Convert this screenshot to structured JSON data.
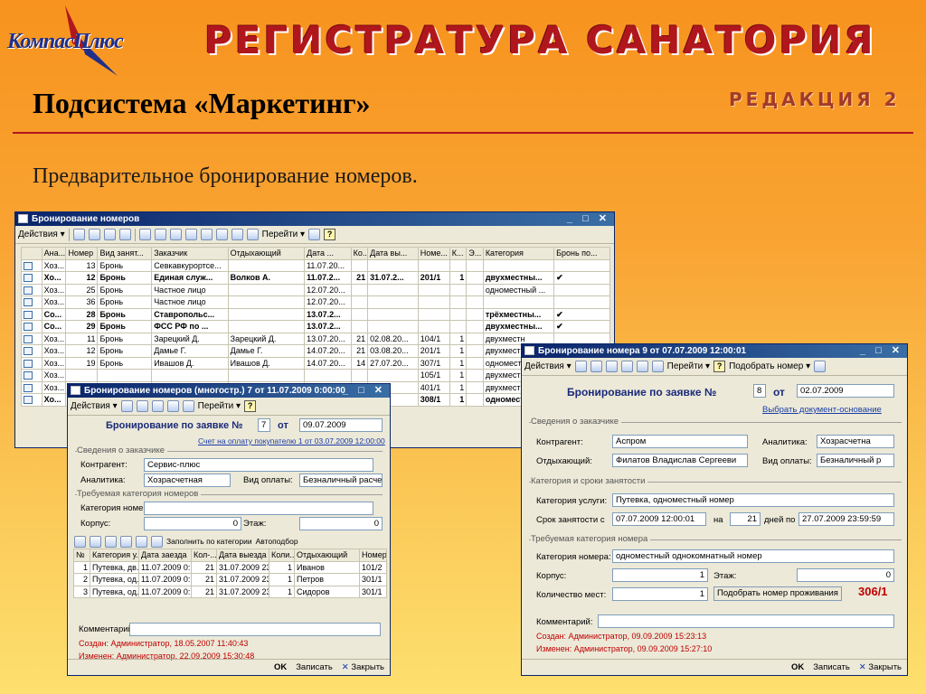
{
  "header": {
    "logo": "КомпасПлюс",
    "banner": "РЕГИСТРАТУРА САНАТОРИЯ",
    "edition": "РЕДАКЦИЯ 2",
    "page_title": "Подсистема «Маркетинг»",
    "subtitle": "Предварительное бронирование номеров."
  },
  "list_window": {
    "title": "Бронирование номеров",
    "controls": "_ □ ✕",
    "toolbar": {
      "actions": "Действия",
      "goto": "Перейти",
      "help": "?"
    },
    "columns": [
      "",
      "Ана...",
      "Номер",
      "Вид занят...",
      "Заказчик",
      "Отдыхающий",
      "Дата ...",
      "Ко...",
      "Дата вы...",
      "Номе...",
      "К...",
      "Э...",
      "Категория",
      "Бронь по..."
    ],
    "rows": [
      {
        "b": false,
        "c": [
          "Хоз...",
          "13",
          "Бронь",
          "Севкавкурортсе...",
          "",
          "11.07.20...",
          "",
          "",
          "",
          "",
          "",
          "",
          ""
        ]
      },
      {
        "b": true,
        "c": [
          "Хо...",
          "12",
          "Бронь",
          "Единая служ...",
          "Волков А.",
          "11.07.2...",
          "21",
          "31.07.2...",
          "201/1",
          "1",
          "",
          "двухместны...",
          "✔"
        ]
      },
      {
        "b": false,
        "c": [
          "Хоз...",
          "25",
          "Бронь",
          "Частное лицо",
          "",
          "12.07.20...",
          "",
          "",
          "",
          "",
          "",
          "одноместный ...",
          ""
        ]
      },
      {
        "b": false,
        "c": [
          "Хоз...",
          "36",
          "Бронь",
          "Частное лицо",
          "",
          "12.07.20...",
          "",
          "",
          "",
          "",
          "",
          "",
          ""
        ]
      },
      {
        "b": true,
        "c": [
          "Со...",
          "28",
          "Бронь",
          "Ставропольс...",
          "",
          "13.07.2...",
          "",
          "",
          "",
          "",
          "",
          "трёхместны...",
          "✔"
        ]
      },
      {
        "b": true,
        "c": [
          "Со...",
          "29",
          "Бронь",
          "ФСС РФ по ...",
          "",
          "13.07.2...",
          "",
          "",
          "",
          "",
          "",
          "двухместны...",
          "✔"
        ]
      },
      {
        "b": false,
        "c": [
          "Хоз...",
          "11",
          "Бронь",
          "Зарецкий Д.",
          "Зарецкий Д.",
          "13.07.20...",
          "21",
          "02.08.20...",
          "104/1",
          "1",
          "",
          "двухместн",
          ""
        ]
      },
      {
        "b": false,
        "c": [
          "Хоз...",
          "12",
          "Бронь",
          "Дамье Г.",
          "Дамье Г.",
          "14.07.20...",
          "21",
          "03.08.20...",
          "201/1",
          "1",
          "",
          "двухместн",
          ""
        ]
      },
      {
        "b": false,
        "c": [
          "Хоз...",
          "19",
          "Бронь",
          "Ивашов Д.",
          "Ивашов Д.",
          "14.07.20...",
          "14",
          "27.07.20...",
          "307/1",
          "1",
          "",
          "одноместн",
          ""
        ]
      },
      {
        "b": false,
        "c": [
          "Хоз...",
          "",
          "",
          "",
          "",
          "",
          "",
          "",
          "105/1",
          "1",
          "",
          "двухместн",
          ""
        ]
      },
      {
        "b": false,
        "c": [
          "Хоз...",
          "",
          "",
          "",
          "",
          "",
          "",
          "",
          "401/1",
          "1",
          "",
          "двухместн",
          ""
        ]
      },
      {
        "b": true,
        "c": [
          "Хо...",
          "",
          "",
          "",
          "",
          "",
          "",
          "7.2...",
          "308/1",
          "1",
          "",
          "одномест",
          ""
        ]
      }
    ]
  },
  "group_window": {
    "title": "Бронирование номеров (многостр.) 7 от 11.07.2009 0:00:00",
    "controls": "_ □ ✕",
    "toolbar": {
      "actions": "Действия",
      "goto": "Перейти"
    },
    "heading": "Бронирование по заявке №",
    "number": "7",
    "from": "от",
    "date": "09.07.2009",
    "invoice_link": "Счет на оплату покупателю 1 от 03.07.2009 12:00:00",
    "customer_group": "Сведения о заказчике",
    "kontragent_label": "Контрагент:",
    "kontragent": "Сервис-плюс",
    "analytics_label": "Аналитика:",
    "analytics": "Хозрасчетная",
    "payment_label": "Вид оплаты:",
    "payment": "Безналичный расчет",
    "category_group": "Требуемая категория номеров",
    "category_label": "Категория номера:",
    "category": "",
    "corpus_label": "Корпус:",
    "corpus": "0",
    "floor_label": "Этаж:",
    "floor": "0",
    "fill_by_category": "Заполнить по категории",
    "auto_select": "Автоподбор",
    "columns": [
      "№",
      "Категория у...",
      "Дата заезда",
      "Кол-...",
      "Дата выезда",
      "Коли...",
      "Отдыхающий",
      "Номер"
    ],
    "rows": [
      [
        "1",
        "Путевка, дв...",
        "11.07.2009 0:...",
        "21",
        "31.07.2009 23...",
        "1",
        "Иванов",
        "101/2"
      ],
      [
        "2",
        "Путевка, од...",
        "11.07.2009 0:...",
        "21",
        "31.07.2009 23...",
        "1",
        "Петров",
        "301/1"
      ],
      [
        "3",
        "Путевка, од...",
        "11.07.2009 0:...",
        "21",
        "31.07.2009 23...",
        "1",
        "Сидоров",
        "301/1"
      ]
    ],
    "comment_label": "Комментарий:",
    "created": "Создан: Администратор, 18.05.2007 11:40:43",
    "modified": "Изменен: Администратор, 22.09.2009 15:30:48",
    "ok": "OK",
    "save": "Записать",
    "close": "Закрыть"
  },
  "single_window": {
    "title": "Бронирование номера 9 от 07.07.2009 12:00:01",
    "controls": "_ □ ✕",
    "toolbar": {
      "actions": "Действия",
      "goto": "Перейти",
      "pick_room": "Подобрать номер"
    },
    "heading": "Бронирование по заявке №",
    "number": "8",
    "from": "от",
    "date": "02.07.2009",
    "base_link": "Выбрать документ-основание",
    "customer_group": "Сведения о заказчике",
    "kontragent_label": "Контрагент:",
    "kontragent": "Аспром",
    "analytics_label": "Аналитика:",
    "analytics": "Хозрасчетна",
    "guest_label": "Отдыхающий:",
    "guest": "Филатов Владислав Сергееви",
    "payment_label": "Вид оплаты:",
    "payment": "Безналичный р",
    "period_group": "Категория и сроки занятости",
    "service_label": "Категория услуги:",
    "service": "Путевка, одноместный номер",
    "stay_label": "Срок занятости с",
    "stay_from": "07.07.2009 12:00:01",
    "na": "на",
    "days": "21",
    "days_to": "дней по",
    "stay_to": "27.07.2009 23:59:59",
    "req_group": "Требуемая категория номера",
    "category_label": "Категория номера:",
    "category": "одноместный однокомнатный номер",
    "corpus_label": "Корпус:",
    "corpus": "1",
    "floor_label": "Этаж:",
    "floor": "0",
    "places_label": "Количество мест:",
    "places": "1",
    "pick_button": "Подобрать номер проживания",
    "room": "306/1",
    "comment_label": "Комментарий:",
    "created": "Создан: Администратор, 09.09.2009 15:23:13",
    "modified": "Изменен: Администратор, 09.09.2009 15:27:10",
    "ok": "OK",
    "save": "Записать",
    "close": "Закрыть"
  },
  "colors": {
    "banner": "#b0171d",
    "titlebar": "#0a246a",
    "window_bg": "#ece9d8",
    "created_text": "#c00000"
  }
}
